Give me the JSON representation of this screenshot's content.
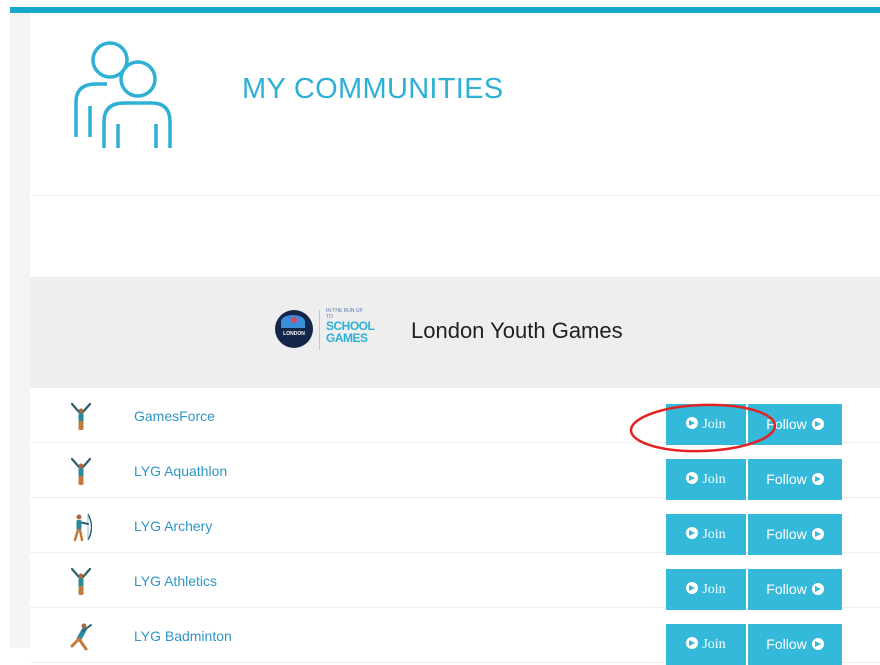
{
  "header": {
    "title": "MY COMMUNITIES",
    "icon": "community-icon"
  },
  "organisation": {
    "name": "London Youth Games",
    "logo_round_text": "LONDON",
    "logo_text_pre": "IN THE RUN UP TO",
    "logo_text_line1": "SCHOOL",
    "logo_text_line2": "GAMES"
  },
  "colors": {
    "accent": "#2eb0d4",
    "button": "#35b9da",
    "top_bar": "#17a8c9",
    "banner_bg": "#eeeeee",
    "annotation": "#e32222"
  },
  "buttons": {
    "join_label": "Join",
    "follow_label": "Follow"
  },
  "communities": [
    {
      "name": "GamesForce",
      "icon": "gymnast-icon"
    },
    {
      "name": "LYG Aquathlon",
      "icon": "gymnast-icon"
    },
    {
      "name": "LYG Archery",
      "icon": "archer-icon"
    },
    {
      "name": "LYG Athletics",
      "icon": "gymnast-icon"
    },
    {
      "name": "LYG Badminton",
      "icon": "badminton-player-icon"
    }
  ]
}
